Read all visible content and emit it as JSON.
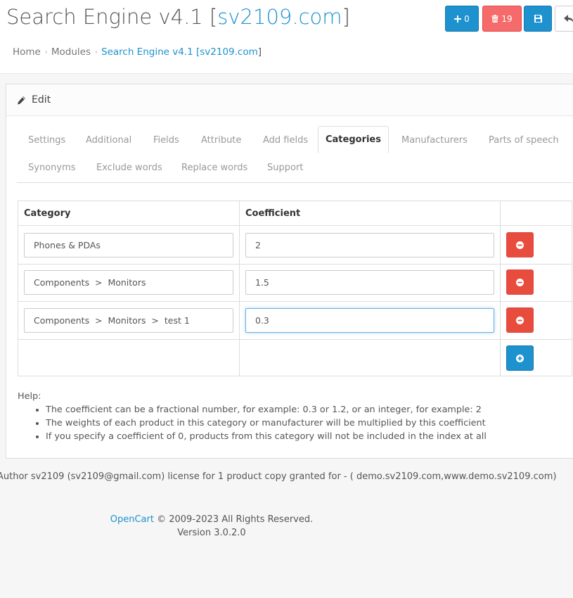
{
  "header": {
    "title_prefix": "Search Engine v4.1 [",
    "title_site": "sv2109.com",
    "title_suffix": "]",
    "add_button_count": "0",
    "delete_button_count": "19"
  },
  "breadcrumb": {
    "home": "Home",
    "modules": "Modules",
    "current": "Search Engine v4.1 [sv2109.com",
    "current_tail": "]"
  },
  "panel": {
    "title": "Edit"
  },
  "tabs": [
    "Settings",
    "Additional",
    "Fields",
    "Attribute",
    "Add fields",
    "Categories",
    "Manufacturers",
    "Parts of speech",
    "Synonyms",
    "Exclude words",
    "Replace words",
    "Support"
  ],
  "active_tab": "Categories",
  "table": {
    "headers": [
      "Category",
      "Coefficient"
    ],
    "rows": [
      {
        "category": "Phones & PDAs",
        "coefficient": "2"
      },
      {
        "category": "Components  >  Monitors",
        "coefficient": "1.5"
      },
      {
        "category": "Components  >  Monitors  >  test 1",
        "coefficient": "0.3"
      }
    ]
  },
  "help": {
    "title": "Help:",
    "items": [
      "The coefficient can be a fractional number, for example: 0.3 or 1.2, or an integer, for example: 2",
      "The weights of each product in this category or manufacturer will be multiplied by this coefficient",
      "If you specify a coefficient of 0, products from this category will not be included in the index at all"
    ]
  },
  "author_line": "Author sv2109 (sv2109@gmail.com) license for 1 product copy granted for - ( demo.sv2109.com,www.demo.sv2109.com)",
  "footer": {
    "brand": "OpenCart",
    "copyright": " © 2009-2023 All Rights Reserved.",
    "version": "Version 3.0.2.0"
  },
  "colors": {
    "primary": "#1e91cf",
    "danger": "#e74c3c",
    "text": "#555555"
  }
}
